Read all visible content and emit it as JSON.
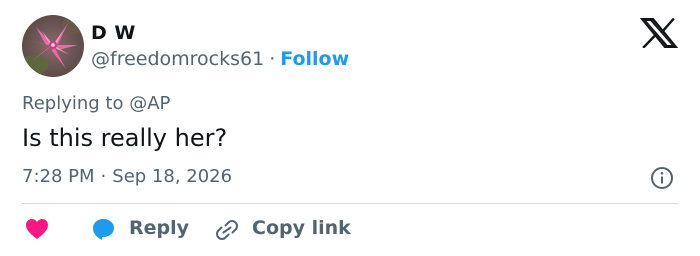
{
  "author": {
    "display_name": "D W",
    "handle": "@freedomrocks61",
    "separator": "·",
    "follow_label": "Follow"
  },
  "logo_icon": "x-logo-icon",
  "reply_context": {
    "prefix": "Replying to ",
    "handle": "@AP"
  },
  "tweet": {
    "text": "Is this really her?",
    "time": "7:28 PM",
    "separator": "·",
    "date": "Sep 18, 2026"
  },
  "info_icon": "info-icon",
  "actions": {
    "like_icon": "heart-icon",
    "reply_icon": "reply-bubble-icon",
    "reply_label": "Reply",
    "copy_icon": "link-icon",
    "copy_label": "Copy link"
  },
  "colors": {
    "accent": "#1d9bf0",
    "like": "#f91880",
    "text_primary": "#0f1419",
    "text_secondary": "#536471",
    "divider": "#cfd9de"
  }
}
